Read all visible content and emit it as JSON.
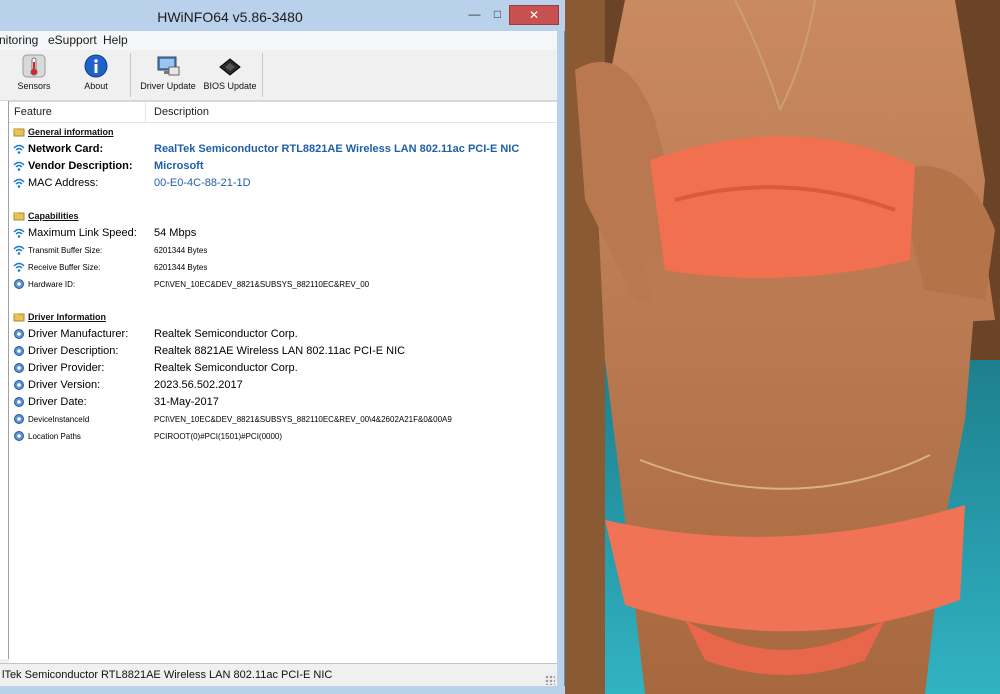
{
  "window": {
    "title": "HWiNFO64 v5.86-3480",
    "min_glyph": "—",
    "max_glyph": "□",
    "close_glyph": "✕"
  },
  "menu": {
    "items": [
      "nitoring",
      "eSupport",
      "Help"
    ]
  },
  "toolbar": {
    "sensors": "Sensors",
    "about": "About",
    "driver_update": "Driver Update",
    "bios_update": "BIOS Update"
  },
  "list": {
    "col_feature": "Feature",
    "col_description": "Description",
    "rows": [
      {
        "feature": "General information",
        "description": ""
      },
      {
        "feature": "Network Card:",
        "description": "RealTek Semiconductor RTL8821AE Wireless LAN 802.11ac PCI-E NIC"
      },
      {
        "feature": "Vendor Description:",
        "description": "Microsoft"
      },
      {
        "feature": "MAC Address:",
        "description": "00-E0-4C-88-21-1D"
      },
      {
        "feature": "Capabilities",
        "description": ""
      },
      {
        "feature": "Maximum Link Speed:",
        "description": "54 Mbps"
      },
      {
        "feature": "Transmit Buffer Size:",
        "description": "6201344 Bytes"
      },
      {
        "feature": "Receive Buffer Size:",
        "description": "6201344 Bytes"
      },
      {
        "feature": "Hardware ID:",
        "description": "PCI\\VEN_10EC&DEV_8821&SUBSYS_882110EC&REV_00"
      },
      {
        "feature": "Driver Information",
        "description": ""
      },
      {
        "feature": "Driver Manufacturer:",
        "description": "Realtek Semiconductor Corp."
      },
      {
        "feature": "Driver Description:",
        "description": "Realtek 8821AE Wireless LAN 802.11ac PCI-E NIC"
      },
      {
        "feature": "Driver Provider:",
        "description": "Realtek Semiconductor Corp."
      },
      {
        "feature": "Driver Version:",
        "description": "2023.56.502.2017"
      },
      {
        "feature": "Driver Date:",
        "description": "31-May-2017"
      },
      {
        "feature": "DeviceInstanceId",
        "description": "PCI\\VEN_10EC&DEV_8821&SUBSYS_882110EC&REV_00\\4&2602A21F&0&00A9"
      },
      {
        "feature": "Location Paths",
        "description": "PCIROOT(0)#PCI(1501)#PCI(0000)"
      }
    ]
  },
  "status": {
    "text": "lTek Semiconductor RTL8821AE Wireless LAN 802.11ac PCI-E NIC"
  },
  "colors": {
    "title_frame": "#b9d1ea",
    "close_button": "#c75050",
    "link_blue": "#1f5fa8"
  },
  "icons": {
    "sensors": "thermometer-icon",
    "about": "info-icon",
    "driver_update": "monitor-icon",
    "bios_update": "chip-icon",
    "section": "folder-icon",
    "network": "wifi-icon",
    "driver": "gear-icon"
  }
}
